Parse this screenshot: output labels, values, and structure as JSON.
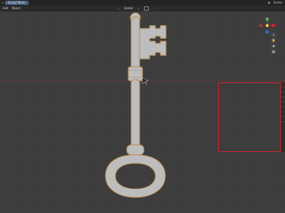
{
  "topbar": {
    "workspace_tab": "Sculpt Mode",
    "scene_label": "Scene"
  },
  "header": {
    "menu": [
      "Edit",
      "Object"
    ],
    "view_label": "Global"
  },
  "colors": {
    "background": "#3d3d3d",
    "model": "#bdbdbd",
    "model_edge": "#b88a4c",
    "selection": "#d4232a",
    "horizon": "#7a3535"
  },
  "icons": [
    "window-menu-icon",
    "view-icon",
    "gizmo-icon",
    "zoom-icon",
    "camera-icon",
    "grid-icon"
  ]
}
